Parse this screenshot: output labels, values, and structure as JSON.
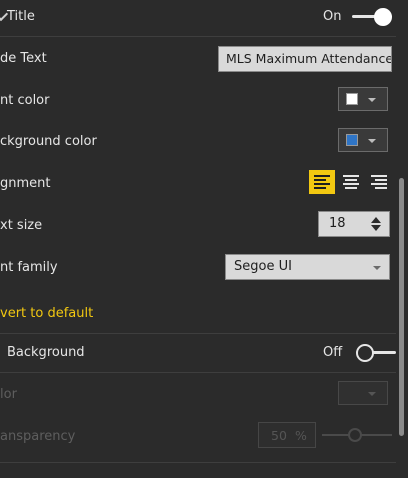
{
  "title_section": {
    "title": "Title",
    "toggle_label": "On",
    "rows": {
      "title_text": {
        "label": "de Text",
        "value": "MLS Maximum Attendance"
      },
      "font_color": {
        "label": "nt color",
        "swatch": "#ffffff"
      },
      "background_color": {
        "label": "ckground color",
        "swatch": "#2f75c6"
      },
      "alignment": {
        "label": "gnment",
        "selected": "left"
      },
      "text_size": {
        "label": "xt size",
        "value": "18"
      },
      "font_family": {
        "label": "nt family",
        "value": "Segoe UI"
      }
    },
    "revert_link": "vert to default"
  },
  "background_section": {
    "title": "Background",
    "toggle_label": "Off",
    "rows": {
      "color": {
        "label": "lor"
      },
      "transparency": {
        "label": "ansparency",
        "value": "50",
        "unit": "%",
        "slider_fraction": 0.5
      }
    }
  },
  "colors": {
    "accent": "#f2c811",
    "panel_bg": "#2b2b2b"
  }
}
